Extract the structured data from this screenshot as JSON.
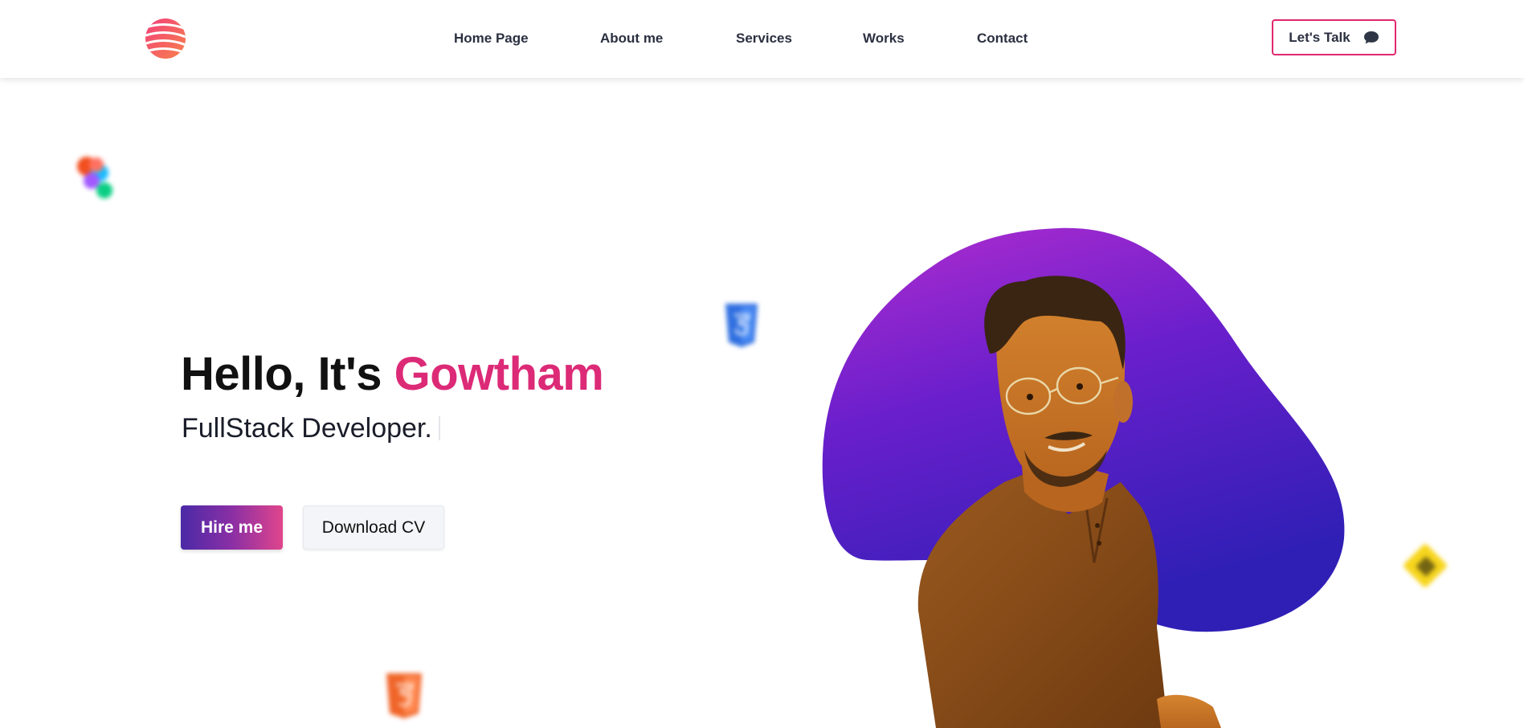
{
  "header": {
    "nav": [
      {
        "label": "Home Page"
      },
      {
        "label": "About me"
      },
      {
        "label": "Services"
      },
      {
        "label": "Works"
      },
      {
        "label": "Contact"
      }
    ],
    "cta_label": "Let's Talk",
    "cta_icon": "chat-bubble-icon"
  },
  "hero": {
    "greeting": "Hello, It's ",
    "name": "Gowtham",
    "subtitle": "FullStack Developer.",
    "hire_label": "Hire me",
    "cv_label": "Download CV"
  },
  "colors": {
    "accent": "#dc2a77",
    "cta_border": "#e0286f",
    "blob_top": "#a22ad2",
    "blob_bottom": "#3a1fb8"
  },
  "decorations": {
    "icons": [
      "figma-icon",
      "css3-icon",
      "html5-icon",
      "javascript-icon"
    ]
  }
}
